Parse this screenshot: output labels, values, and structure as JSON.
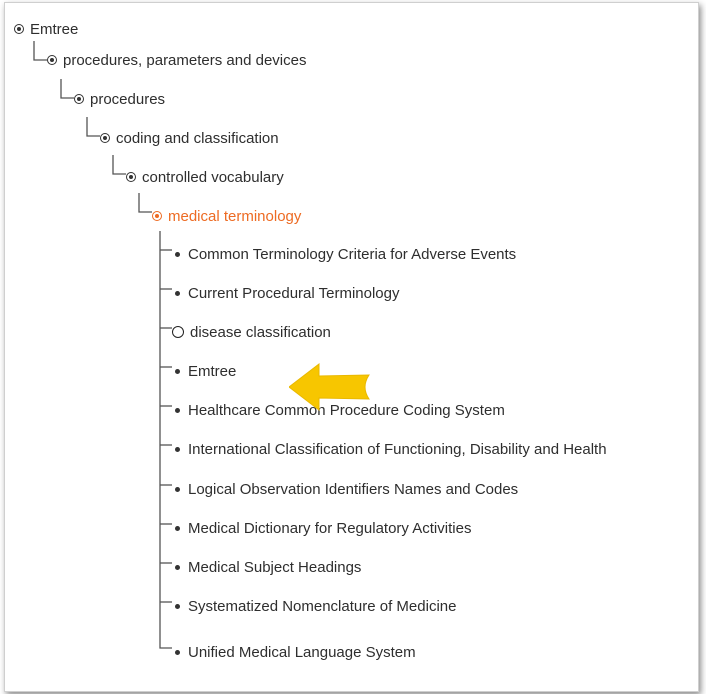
{
  "tree": {
    "ancestors": [
      {
        "label": "Emtree"
      },
      {
        "label": "procedures, parameters and devices"
      },
      {
        "label": "procedures"
      },
      {
        "label": "coding and classification"
      },
      {
        "label": "controlled vocabulary"
      },
      {
        "label": "medical terminology",
        "selected": true
      }
    ],
    "children": [
      {
        "label": "Common Terminology Criteria for Adverse Events",
        "type": "leaf"
      },
      {
        "label": "Current Procedural Terminology",
        "type": "leaf"
      },
      {
        "label": "disease classification",
        "type": "expandable"
      },
      {
        "label": "Emtree",
        "type": "leaf",
        "highlighted": true
      },
      {
        "label": "Healthcare Common Procedure Coding System",
        "type": "leaf"
      },
      {
        "label": "International Classification of Functioning, Disability and Health",
        "type": "leaf"
      },
      {
        "label": "Logical Observation Identifiers Names and Codes",
        "type": "leaf"
      },
      {
        "label": "Medical Dictionary for Regulatory Activities",
        "type": "leaf"
      },
      {
        "label": "Medical Subject Headings",
        "type": "leaf"
      },
      {
        "label": "Systematized Nomenclature of Medicine",
        "type": "leaf"
      },
      {
        "label": "Unified Medical Language System",
        "type": "leaf"
      }
    ]
  },
  "colors": {
    "selected": "#ed6b23",
    "text": "#2e2e2e",
    "connector": "#555555",
    "highlight_arrow": "#f7c600"
  },
  "icons": {
    "ancestor": "open-node-icon",
    "expandable": "collapsed-node-icon",
    "leaf": "leaf-bullet-icon",
    "callout": "arrow-left-icon"
  }
}
